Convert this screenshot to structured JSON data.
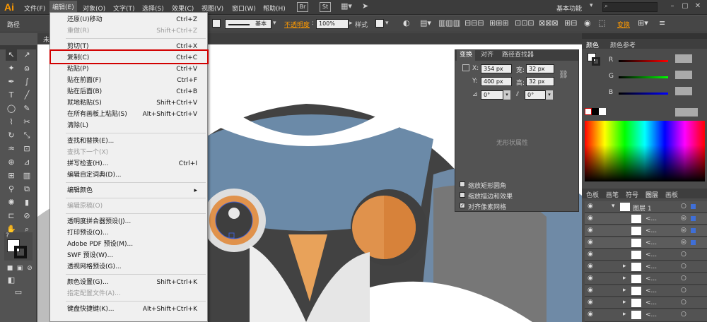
{
  "menubar": {
    "logo": "Ai",
    "items": [
      "文件(F)",
      "编辑(E)",
      "对象(O)",
      "文字(T)",
      "选择(S)",
      "效果(C)",
      "视图(V)",
      "窗口(W)",
      "帮助(H)"
    ],
    "workspace": "基本功能",
    "br_badge": "Br",
    "st_badge": "St"
  },
  "control": {
    "path_label": "路径",
    "stroke_label": "基本",
    "opacity_label": "不透明度",
    "opacity_value": "100%",
    "style_label": "样式",
    "transform_label": "变换"
  },
  "document_tab": "未",
  "menu": {
    "items": [
      {
        "label": "还原(U)移动",
        "shortcut": "Ctrl+Z",
        "disabled": false
      },
      {
        "label": "重做(R)",
        "shortcut": "Shift+Ctrl+Z",
        "disabled": true
      },
      {
        "label": "剪切(T)",
        "shortcut": "Ctrl+X",
        "disabled": false
      },
      {
        "label": "复制(C)",
        "shortcut": "Ctrl+C",
        "disabled": false
      },
      {
        "label": "粘贴(P)",
        "shortcut": "Ctrl+V",
        "disabled": false
      },
      {
        "label": "贴在前面(F)",
        "shortcut": "Ctrl+F",
        "disabled": false
      },
      {
        "label": "贴在后面(B)",
        "shortcut": "Ctrl+B",
        "disabled": false
      },
      {
        "label": "就地粘贴(S)",
        "shortcut": "Shift+Ctrl+V",
        "disabled": false
      },
      {
        "label": "在所有画板上粘贴(S)",
        "shortcut": "Alt+Shift+Ctrl+V",
        "disabled": false
      },
      {
        "label": "清除(L)",
        "shortcut": "",
        "disabled": false
      },
      {
        "label": "查找和替换(E)...",
        "shortcut": "",
        "disabled": false
      },
      {
        "label": "查找下一个(X)",
        "shortcut": "",
        "disabled": true
      },
      {
        "label": "拼写检查(H)...",
        "shortcut": "Ctrl+I",
        "disabled": false
      },
      {
        "label": "编辑自定词典(D)...",
        "shortcut": "",
        "disabled": false
      },
      {
        "label": "编辑颜色",
        "shortcut": "▸",
        "disabled": false
      },
      {
        "label": "编辑原稿(O)",
        "shortcut": "",
        "disabled": true
      },
      {
        "label": "透明度拼合器预设(J)...",
        "shortcut": "",
        "disabled": false
      },
      {
        "label": "打印预设(Q)...",
        "shortcut": "",
        "disabled": false
      },
      {
        "label": "Adobe PDF 预设(M)...",
        "shortcut": "",
        "disabled": false
      },
      {
        "label": "SWF 预设(W)...",
        "shortcut": "",
        "disabled": false
      },
      {
        "label": "透视网格预设(G)...",
        "shortcut": "",
        "disabled": false
      },
      {
        "label": "颜色设置(G)...",
        "shortcut": "Shift+Ctrl+K",
        "disabled": false
      },
      {
        "label": "指定配置文件(A)...",
        "shortcut": "",
        "disabled": true
      },
      {
        "label": "键盘快捷键(K)...",
        "shortcut": "Alt+Shift+Ctrl+K",
        "disabled": false
      }
    ]
  },
  "transform": {
    "tabs": [
      "变换",
      "对齐",
      "路径查找器"
    ],
    "x_label": "X:",
    "x": "354 px",
    "y_label": "Y:",
    "y": "400 px",
    "w_label": "宽:",
    "w": "32 px",
    "h_label": "高:",
    "h": "32 px",
    "rotate": "0°",
    "shear": "0°",
    "no_shape": "无形状属性",
    "opt1": "缩放矩形圆角",
    "opt2": "缩放描边和效果",
    "opt3": "对齐像素网格"
  },
  "color_panel": {
    "tabs": [
      "颜色",
      "颜色参考"
    ],
    "channels": [
      "R",
      "G",
      "B"
    ]
  },
  "layers_panel": {
    "tabs": [
      "色板",
      "画笔",
      "符号",
      "图层",
      "画板"
    ],
    "layer_name": "图层 1",
    "sub_label": "<..."
  },
  "colors": {
    "accent_orange": "#ff9a00",
    "highlight_red": "#d20000",
    "art_blue": "#6b8aa8",
    "art_orange": "#e8a25a",
    "art_dark": "#404040"
  }
}
